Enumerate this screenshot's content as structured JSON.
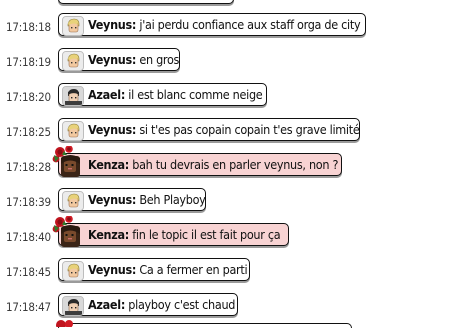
{
  "messages": [
    {
      "time": "17:18:18",
      "user": "Veynus:",
      "text": "j'ai perdu confiance aux staff orga de city",
      "avatar": "veynus",
      "highlight": false
    },
    {
      "time": "17:18:19",
      "user": "Veynus:",
      "text": "en gros",
      "avatar": "veynus",
      "highlight": false
    },
    {
      "time": "17:18:20",
      "user": "Azael:",
      "text": "il est blanc comme neige",
      "avatar": "azael",
      "highlight": false
    },
    {
      "time": "17:18:25",
      "user": "Veynus:",
      "text": "si t'es pas copain copain t'es grave limité",
      "avatar": "veynus",
      "highlight": false
    },
    {
      "time": "17:18:28",
      "user": "Kenza:",
      "text": "bah tu devrais en parler veynus, non ?",
      "avatar": "kenza",
      "highlight": true
    },
    {
      "time": "17:18:39",
      "user": "Veynus:",
      "text": "Beh Playboy",
      "avatar": "veynus",
      "highlight": false
    },
    {
      "time": "17:18:40",
      "user": "Kenza:",
      "text": "fin le topic il est fait pour ça",
      "avatar": "kenza",
      "highlight": true
    },
    {
      "time": "17:18:45",
      "user": "Veynus:",
      "text": "Ca a fermer en parti",
      "avatar": "veynus",
      "highlight": false
    },
    {
      "time": "17:18:47",
      "user": "Azael:",
      "text": "playboy c'est chaud",
      "avatar": "azael",
      "highlight": false
    }
  ],
  "colors": {
    "bubble": "#ffffff",
    "bubble_highlight": "#f8d3d3",
    "timestamp": "#3a3a3a",
    "border": "#111111"
  }
}
